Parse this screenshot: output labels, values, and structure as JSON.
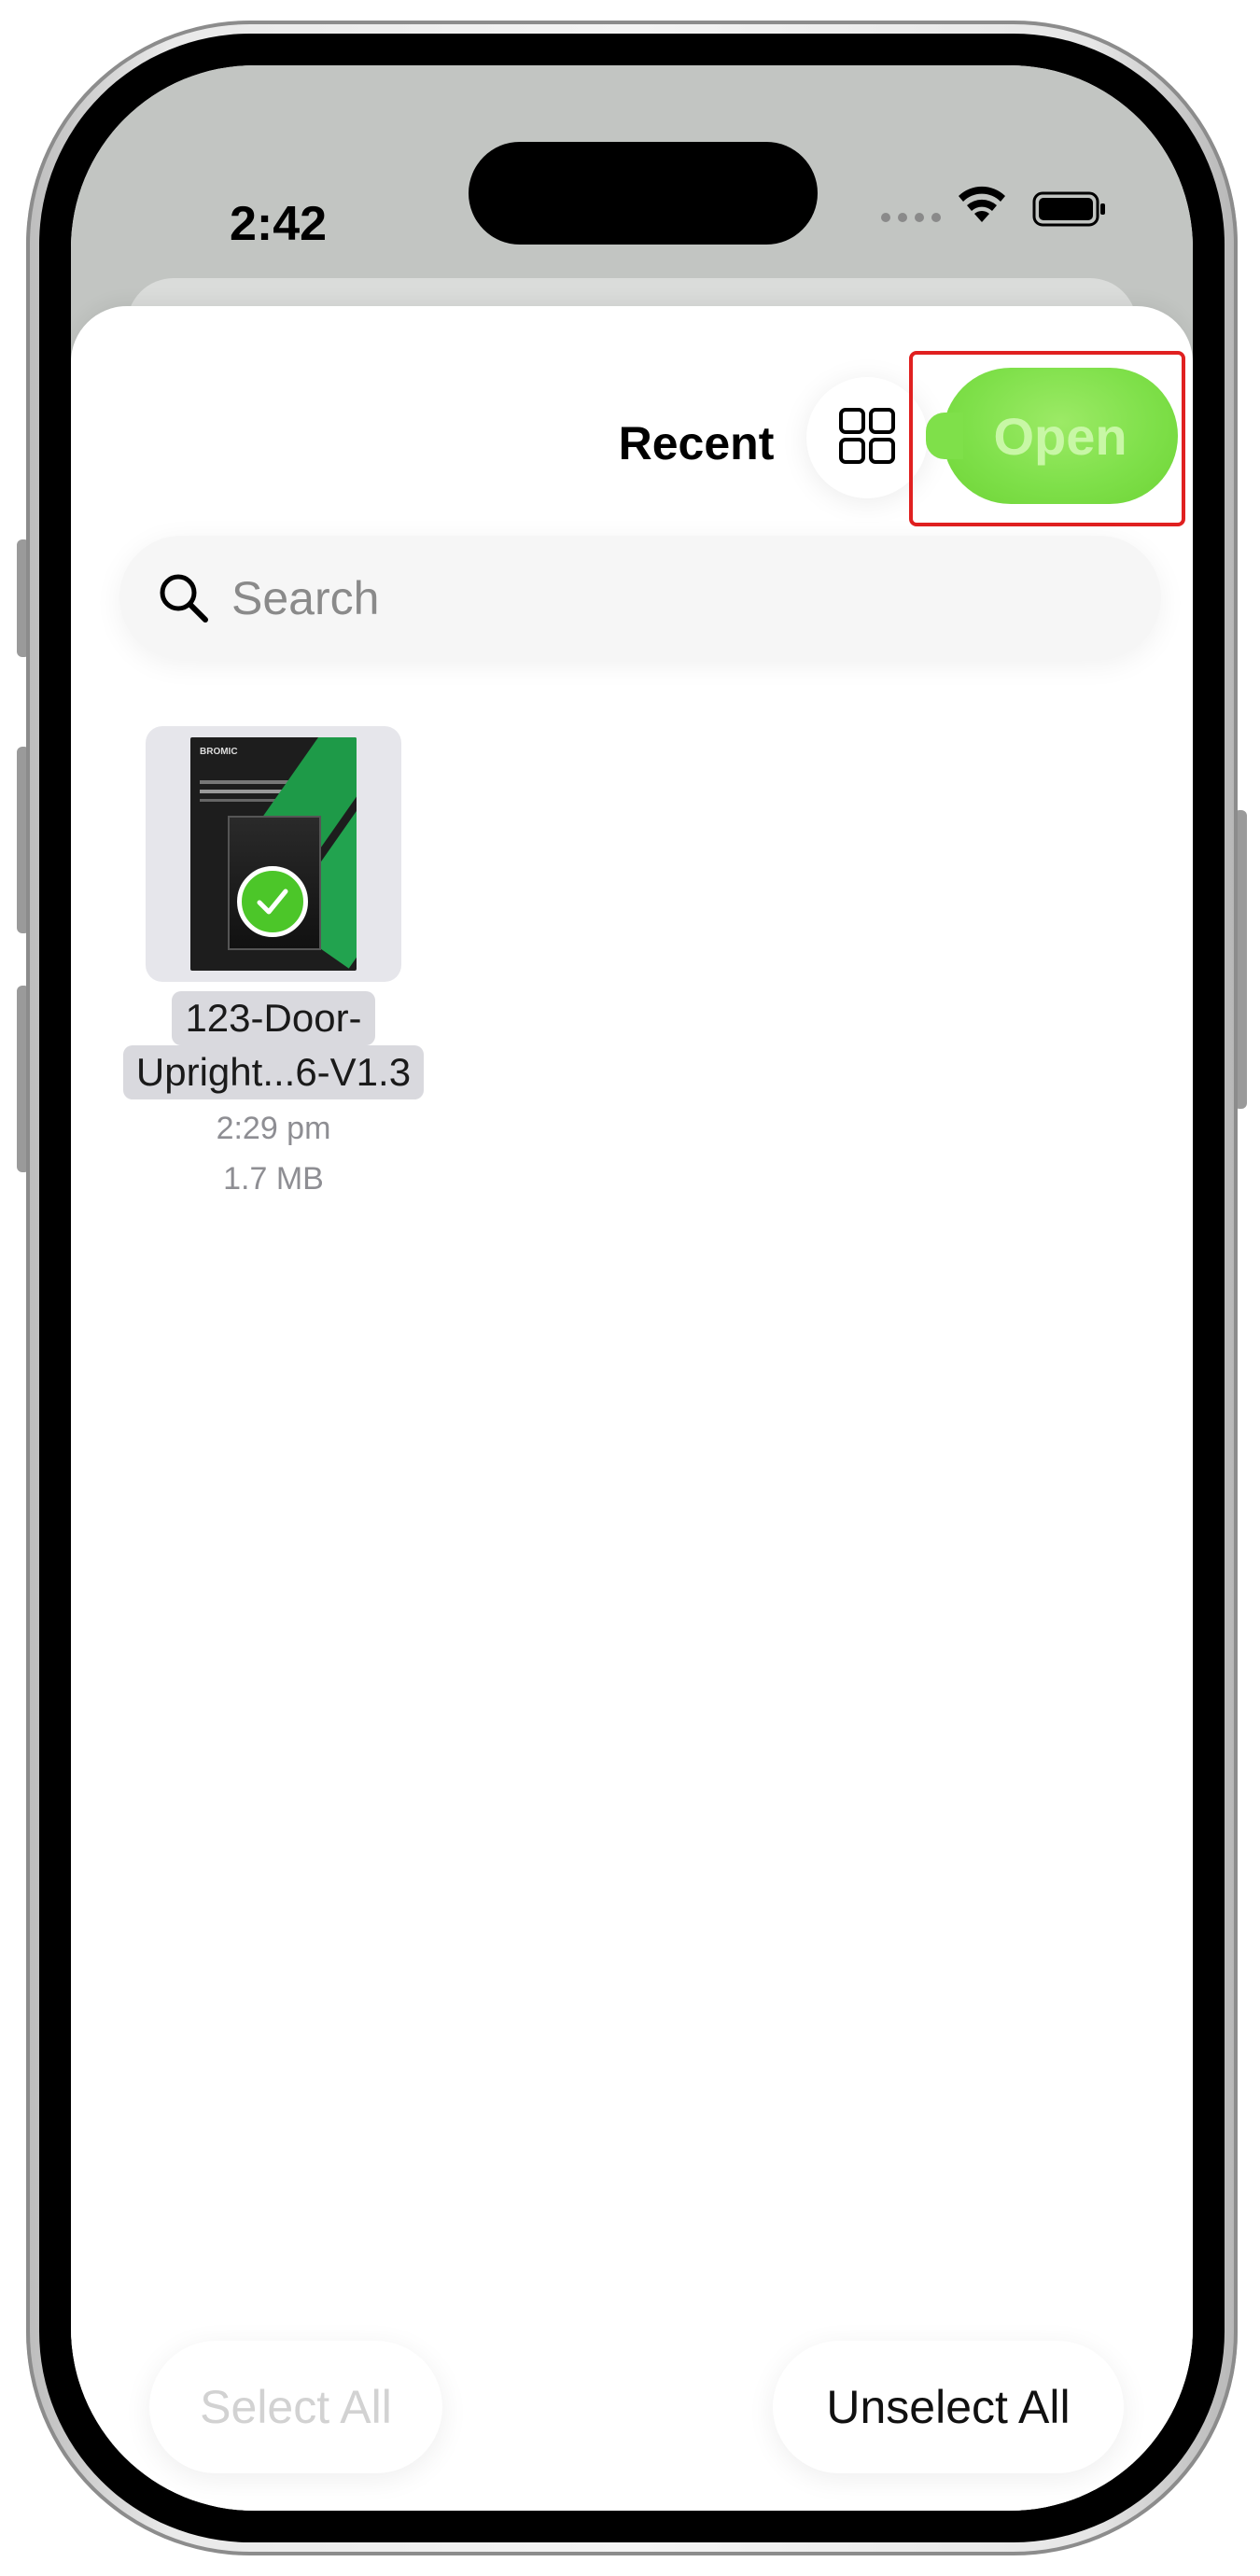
{
  "status_bar": {
    "time": "2:42"
  },
  "sheet": {
    "title": "Recent",
    "open_label": "Open"
  },
  "search": {
    "placeholder": "Search"
  },
  "file": {
    "name_line1": "123-Door-",
    "name_line2": "Upright...6-V1.3",
    "time": "2:29 pm",
    "size": "1.7 MB",
    "selected": true,
    "thumbnail_brand": "BROMIC"
  },
  "footer": {
    "select_all_label": "Select All",
    "unselect_all_label": "Unselect All"
  },
  "colors": {
    "open_button": "#7fe04a",
    "check_badge": "#4cc629",
    "highlight_box": "#e02020"
  }
}
